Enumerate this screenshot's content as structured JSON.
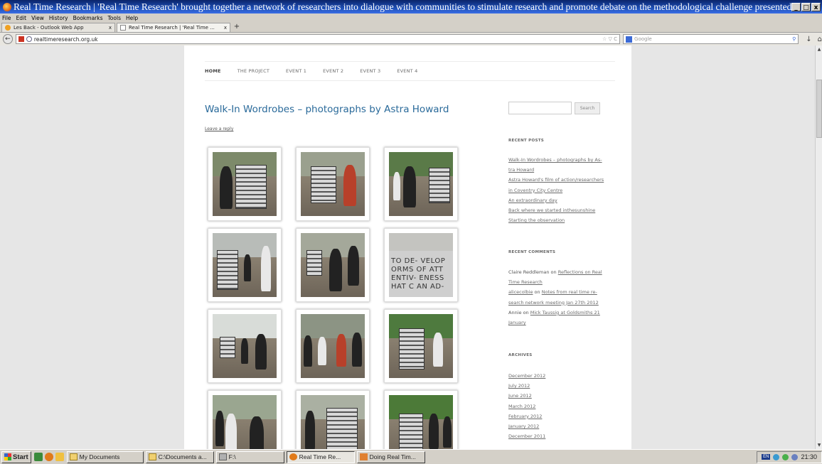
{
  "window": {
    "title": "Real Time Research | 'Real Time Research' brought together a network of researchers into dialogue with communities to stimulate research and promote debate on the methodological challenge presented by real time rese...",
    "controls": [
      "_",
      "□",
      "x"
    ]
  },
  "menu": [
    "File",
    "Edit",
    "View",
    "History",
    "Bookmarks",
    "Tools",
    "Help"
  ],
  "tabs": [
    {
      "label": "Les Back - Outlook Web App",
      "close": "x"
    },
    {
      "label": "Real Time Research | 'Real Time ...",
      "close": "x"
    }
  ],
  "newtab_label": "+",
  "navbar": {
    "back": "←",
    "url": "realtimeresearch.org.uk",
    "url_tail": "☆ ▽ C",
    "search_placeholder": "Google",
    "icons": [
      "↓",
      "⌂"
    ]
  },
  "site": {
    "nav": [
      "HOME",
      "THE PROJECT",
      "EVENT 1",
      "EVENT 2",
      "EVENT 3",
      "EVENT 4"
    ],
    "post_title": "Walk-In Wordrobes – photographs by Astra Howard",
    "leave_reply": "Leave a reply",
    "photo_board_text": [
      "TO DE- VELOP",
      "ORMS OF ATT",
      "ENTIV- ENESS",
      "HAT C AN AD-"
    ],
    "search_button": "Search",
    "recent_posts_heading": "RECENT POSTS",
    "recent_posts": [
      "Walk-In Wordrobes – photographs by As-",
      "tra Howard",
      "Astra Howard's film of action/researchers",
      "in Coventry City Centre",
      "An extraordinary day",
      "Back where we started inthesunshine",
      "Starting the observation"
    ],
    "recent_comments_heading": "RECENT COMMENTS",
    "recent_comments": [
      {
        "author": "Claire Reddleman",
        "on": "on",
        "link": "Reflections on Real"
      },
      {
        "author": "",
        "on": "",
        "link": "Time Research"
      },
      {
        "author": "",
        "on": "on",
        "link": "alicecolbie",
        "author_link": true,
        "rest": "Notes from real time re-"
      },
      {
        "author": "",
        "on": "",
        "link": "search network meeting Jan 27th 2012"
      },
      {
        "author": "Annie",
        "on": "on",
        "link": "Mick Taussig at Goldsmiths 21"
      },
      {
        "author": "",
        "on": "",
        "link": "January"
      }
    ],
    "archives_heading": "ARCHIVES",
    "archives": [
      "December 2012",
      "July 2012",
      "June 2012",
      "March 2012",
      "February 2012",
      "January 2012",
      "December 2011"
    ]
  },
  "taskbar": {
    "start": "Start",
    "items": [
      "My Documents",
      "C:\\Documents a...",
      "F:\\",
      "Real Time Re...",
      "Doing Real Tim..."
    ],
    "lang": "EN",
    "clock": "21:30"
  }
}
